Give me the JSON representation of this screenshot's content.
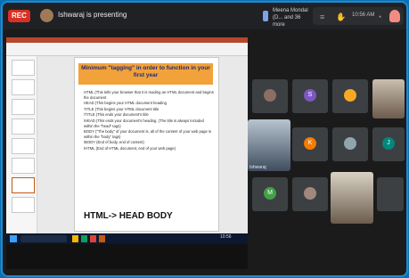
{
  "topbar": {
    "rec_label": "REC",
    "presenting_text": "Ishwaraj is presenting",
    "meeting_info": "Meena Mondal (D... and 36 more",
    "clock_text": "10:56 AM",
    "icons": [
      "pin-icon",
      "captions-icon",
      "hand-icon",
      "clock-icon",
      "account-icon"
    ]
  },
  "share": {
    "slide_title": "Minimum \"tagging\" in order to function in your first year",
    "slide_items": [
      "HTML (This tells your browser that it is reading an HTML document and begins the document",
      "HEAD (This begins your HTML document heading",
      "TITLE (This begins your HTML document title",
      "/TITLE (This ends your document's title",
      "/HEAD (This ends your document's heading. (The title is always included within the \"head\" tags)",
      "BODY (\"The body\" of your document is, all of the content of your web page is within the \"body\" tags)",
      "/BODY (End of body, end of content)",
      "/HTML (End of HTML document, end of your web page)"
    ],
    "slide_footer": "HTML-> HEAD BODY",
    "taskbar_time": "10:56"
  },
  "participants": [
    {
      "initial": "",
      "color": "#8d6e63"
    },
    {
      "initial": "S",
      "color": "#7e57c2"
    },
    {
      "initial": "",
      "color": "#f9a825"
    },
    {
      "initial": "",
      "color": "#5d4037"
    },
    {
      "initial": "K",
      "color": "#f57c00"
    },
    {
      "initial": "",
      "color": "#90a4ae"
    },
    {
      "initial": "J",
      "color": "#00897b"
    },
    {
      "initial": "M",
      "color": "#43a047"
    },
    {
      "initial": "",
      "color": "#a1887f"
    },
    {
      "initial": "",
      "color": "#3c4043"
    }
  ],
  "you_label": "Ishwaraj"
}
